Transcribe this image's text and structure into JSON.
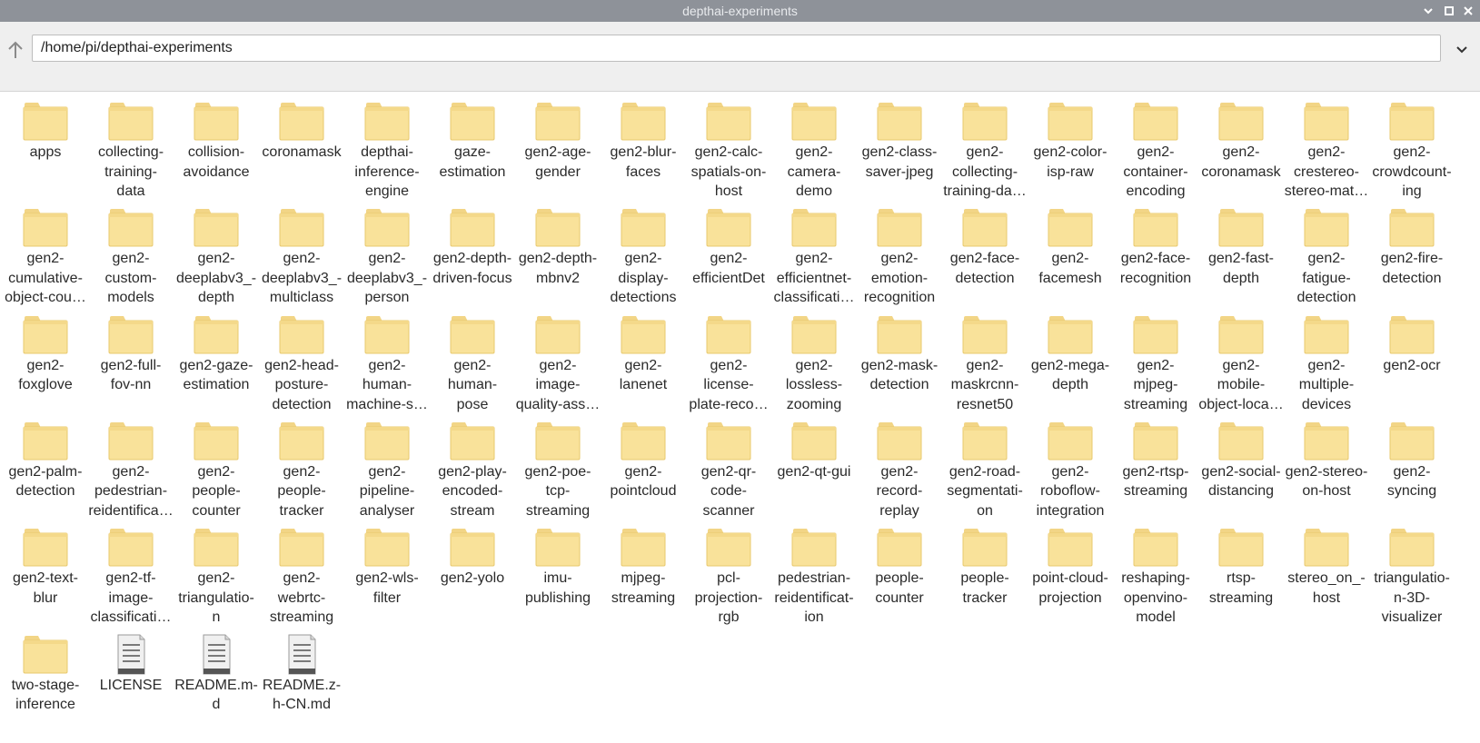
{
  "window": {
    "title": "depthai-experiments"
  },
  "address": {
    "path": "/home/pi/depthai-experiments"
  },
  "icons": {
    "up": "up-arrow-icon",
    "dropdown": "chevron-down-icon",
    "minimize": "minimize-icon",
    "maximize": "maximize-icon",
    "close": "close-icon",
    "folder": "folder-icon",
    "file": "text-file-icon"
  },
  "colors": {
    "titlebar": "#8e9299",
    "folder": "#f9e29a",
    "folder_tab": "#f2d586"
  },
  "items": [
    {
      "label": "apps",
      "type": "folder"
    },
    {
      "label": "collecting-\ntraining-\ndata",
      "type": "folder"
    },
    {
      "label": "collision-\navoidance",
      "type": "folder"
    },
    {
      "label": "coronamask",
      "type": "folder"
    },
    {
      "label": "depthai-\ninference-\nengine",
      "type": "folder"
    },
    {
      "label": "gaze-\nestimation",
      "type": "folder"
    },
    {
      "label": "gen2-age-\ngender",
      "type": "folder"
    },
    {
      "label": "gen2-blur-\nfaces",
      "type": "folder"
    },
    {
      "label": "gen2-calc-\nspatials-on-\nhost",
      "type": "folder"
    },
    {
      "label": "gen2-\ncamera-\ndemo",
      "type": "folder"
    },
    {
      "label": "gen2-class-\nsaver-jpeg",
      "type": "folder"
    },
    {
      "label": "gen2-\ncollecting-\ntraining-da…",
      "type": "folder"
    },
    {
      "label": "gen2-color-\nisp-raw",
      "type": "folder"
    },
    {
      "label": "gen2-\ncontainer-\nencoding",
      "type": "folder"
    },
    {
      "label": "gen2-\ncoronamask",
      "type": "folder"
    },
    {
      "label": "gen2-\ncrestereo-\nstereo-mat…",
      "type": "folder"
    },
    {
      "label": "gen2-\ncrowdcount-\ning",
      "type": "folder"
    },
    {
      "label": "gen2-\ncumulative-\nobject-cou…",
      "type": "folder"
    },
    {
      "label": "gen2-\ncustom-\nmodels",
      "type": "folder"
    },
    {
      "label": "gen2-\ndeeplabv3_-\ndepth",
      "type": "folder"
    },
    {
      "label": "gen2-\ndeeplabv3_-\nmulticlass",
      "type": "folder"
    },
    {
      "label": "gen2-\ndeeplabv3_-\nperson",
      "type": "folder"
    },
    {
      "label": "gen2-depth-\ndriven-focus",
      "type": "folder"
    },
    {
      "label": "gen2-depth-\nmbnv2",
      "type": "folder"
    },
    {
      "label": "gen2-\ndisplay-\ndetections",
      "type": "folder"
    },
    {
      "label": "gen2-\nefficientDet",
      "type": "folder"
    },
    {
      "label": "gen2-\nefficientnet-\nclassificati…",
      "type": "folder"
    },
    {
      "label": "gen2-\nemotion-\nrecognition",
      "type": "folder"
    },
    {
      "label": "gen2-face-\ndetection",
      "type": "folder"
    },
    {
      "label": "gen2-\nfacemesh",
      "type": "folder"
    },
    {
      "label": "gen2-face-\nrecognition",
      "type": "folder"
    },
    {
      "label": "gen2-fast-\ndepth",
      "type": "folder"
    },
    {
      "label": "gen2-\nfatigue-\ndetection",
      "type": "folder"
    },
    {
      "label": "gen2-fire-\ndetection",
      "type": "folder"
    },
    {
      "label": "gen2-\nfoxglove",
      "type": "folder"
    },
    {
      "label": "gen2-full-\nfov-nn",
      "type": "folder"
    },
    {
      "label": "gen2-gaze-\nestimation",
      "type": "folder"
    },
    {
      "label": "gen2-head-\nposture-\ndetection",
      "type": "folder"
    },
    {
      "label": "gen2-\nhuman-\nmachine-s…",
      "type": "folder"
    },
    {
      "label": "gen2-\nhuman-\npose",
      "type": "folder"
    },
    {
      "label": "gen2-\nimage-\nquality-ass…",
      "type": "folder"
    },
    {
      "label": "gen2-\nlanenet",
      "type": "folder"
    },
    {
      "label": "gen2-\nlicense-\nplate-reco…",
      "type": "folder"
    },
    {
      "label": "gen2-\nlossless-\nzooming",
      "type": "folder"
    },
    {
      "label": "gen2-mask-\ndetection",
      "type": "folder"
    },
    {
      "label": "gen2-\nmaskrcnn-\nresnet50",
      "type": "folder"
    },
    {
      "label": "gen2-mega-\ndepth",
      "type": "folder"
    },
    {
      "label": "gen2-\nmjpeg-\nstreaming",
      "type": "folder"
    },
    {
      "label": "gen2-\nmobile-\nobject-loca…",
      "type": "folder"
    },
    {
      "label": "gen2-\nmultiple-\ndevices",
      "type": "folder"
    },
    {
      "label": "gen2-ocr",
      "type": "folder"
    },
    {
      "label": "gen2-palm-\ndetection",
      "type": "folder"
    },
    {
      "label": "gen2-\npedestrian-\nreidentifica…",
      "type": "folder"
    },
    {
      "label": "gen2-\npeople-\ncounter",
      "type": "folder"
    },
    {
      "label": "gen2-\npeople-\ntracker",
      "type": "folder"
    },
    {
      "label": "gen2-\npipeline-\nanalyser",
      "type": "folder"
    },
    {
      "label": "gen2-play-\nencoded-\nstream",
      "type": "folder"
    },
    {
      "label": "gen2-poe-\ntcp-\nstreaming",
      "type": "folder"
    },
    {
      "label": "gen2-\npointcloud",
      "type": "folder"
    },
    {
      "label": "gen2-qr-\ncode-\nscanner",
      "type": "folder"
    },
    {
      "label": "gen2-qt-gui",
      "type": "folder"
    },
    {
      "label": "gen2-\nrecord-\nreplay",
      "type": "folder"
    },
    {
      "label": "gen2-road-\nsegmentati-\non",
      "type": "folder"
    },
    {
      "label": "gen2-\nroboflow-\nintegration",
      "type": "folder"
    },
    {
      "label": "gen2-rtsp-\nstreaming",
      "type": "folder"
    },
    {
      "label": "gen2-social-\ndistancing",
      "type": "folder"
    },
    {
      "label": "gen2-stereo-\non-host",
      "type": "folder"
    },
    {
      "label": "gen2-\nsyncing",
      "type": "folder"
    },
    {
      "label": "gen2-text-\nblur",
      "type": "folder"
    },
    {
      "label": "gen2-tf-\nimage-\nclassificati…",
      "type": "folder"
    },
    {
      "label": "gen2-\ntriangulatio-\nn",
      "type": "folder"
    },
    {
      "label": "gen2-\nwebrtc-\nstreaming",
      "type": "folder"
    },
    {
      "label": "gen2-wls-\nfilter",
      "type": "folder"
    },
    {
      "label": "gen2-yolo",
      "type": "folder"
    },
    {
      "label": "imu-\npublishing",
      "type": "folder"
    },
    {
      "label": "mjpeg-\nstreaming",
      "type": "folder"
    },
    {
      "label": "pcl-\nprojection-\nrgb",
      "type": "folder"
    },
    {
      "label": "pedestrian-\nreidentificat-\nion",
      "type": "folder"
    },
    {
      "label": "people-\ncounter",
      "type": "folder"
    },
    {
      "label": "people-\ntracker",
      "type": "folder"
    },
    {
      "label": "point-cloud-\nprojection",
      "type": "folder"
    },
    {
      "label": "reshaping-\nopenvino-\nmodel",
      "type": "folder"
    },
    {
      "label": "rtsp-\nstreaming",
      "type": "folder"
    },
    {
      "label": "stereo_on_-\nhost",
      "type": "folder"
    },
    {
      "label": "triangulatio-\nn-3D-\nvisualizer",
      "type": "folder"
    },
    {
      "label": "two-stage-\ninference",
      "type": "folder"
    },
    {
      "label": "LICENSE",
      "type": "file"
    },
    {
      "label": "README.m-\nd",
      "type": "file"
    },
    {
      "label": "README.z-\nh-CN.md",
      "type": "file"
    }
  ]
}
